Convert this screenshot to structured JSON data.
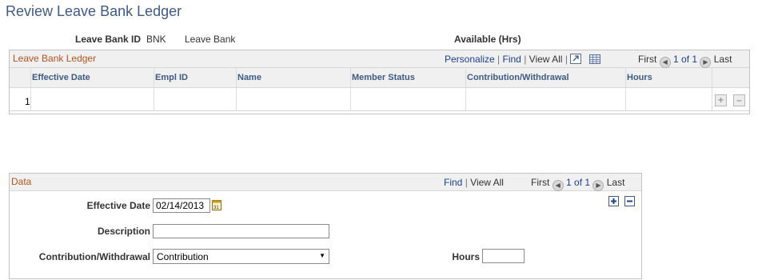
{
  "page": {
    "title": "Review Leave Bank Ledger"
  },
  "header": {
    "leave_bank_id_label": "Leave Bank ID",
    "leave_bank_id_value": "BNK",
    "leave_bank_name": "Leave Bank",
    "available_label": "Available (Hrs)"
  },
  "ledger": {
    "title": "Leave Bank Ledger",
    "nav": {
      "personalize": "Personalize",
      "sep1": "|",
      "find": "Find",
      "sep2": "|",
      "view_all": "View All",
      "sep3": "|",
      "first": "First",
      "range": "1 of 1",
      "last": "Last"
    },
    "columns": [
      "Effective Date",
      "Empl ID",
      "Name",
      "Member Status",
      "Contribution/Withdrawal",
      "Hours"
    ],
    "rows": [
      {
        "num": "1"
      }
    ]
  },
  "data_box": {
    "title": "Data",
    "nav": {
      "find": "Find",
      "sep": "|",
      "view_all": "View All",
      "first": "First",
      "range": "1 of 1",
      "last": "Last"
    },
    "effective_date_label": "Effective Date",
    "effective_date_value": "02/14/2013",
    "description_label": "Description",
    "description_value": "",
    "contribution_label": "Contribution/Withdrawal",
    "contribution_value": "Contribution",
    "hours_label": "Hours",
    "hours_value": ""
  },
  "icons": {
    "zoom": "zoom-icon",
    "download": "spreadsheet-icon",
    "calendar": "calendar-icon",
    "prev": "previous-arrow-icon",
    "next": "next-arrow-icon"
  },
  "colors": {
    "title": "#3f5a84",
    "section_title": "#b3541e",
    "link": "#1c3f8f"
  }
}
